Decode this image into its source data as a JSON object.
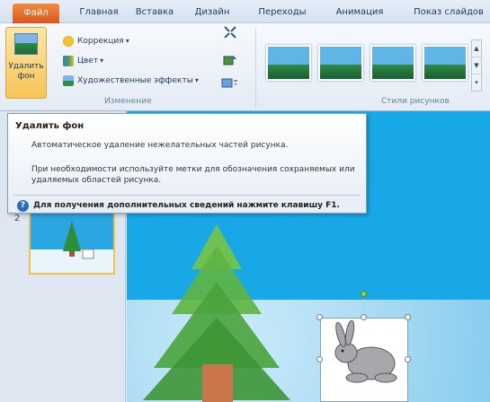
{
  "tabs": {
    "file": "Файл",
    "items": [
      "Главная",
      "Вставка",
      "Дизайн",
      "Переходы",
      "Анимация",
      "Показ слайдов"
    ]
  },
  "ribbon": {
    "remove_background_label": "Удалить фон",
    "correction_label": "Коррекция",
    "color_label": "Цвет",
    "artistic_effects_label": "Художественные эффекты",
    "change_group_label": "Изменение",
    "picture_styles_group_label": "Стили рисунков",
    "dropdown_caret": "▾"
  },
  "tooltip": {
    "title": "Удалить фон",
    "description": "Автоматическое удаление нежелательных частей рисунка.",
    "details": "При необходимости используйте метки для обозначения сохраняемых или удаляемых областей рисунка.",
    "help_icon": "?",
    "help_text": "Для получения дополнительных сведений нажмите клавишу F1."
  },
  "slides_panel": {
    "slide_number": "2"
  },
  "colors": {
    "file_tab": "#e06a26",
    "canvas_bg": "#18a8e7",
    "selected_button": "#f7c456",
    "thumb_border": "#f1c246"
  }
}
